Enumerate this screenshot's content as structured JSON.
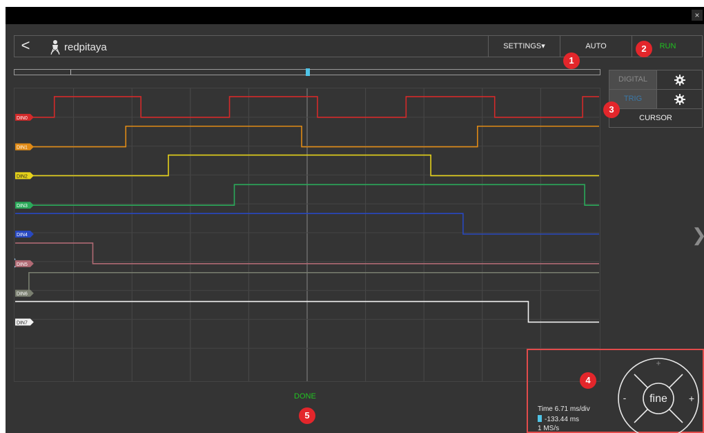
{
  "window": {
    "close_label": "×"
  },
  "header": {
    "back_label": "<",
    "logo_text": "redpitaya",
    "settings_label": "SETTINGS▾",
    "auto_label": "AUTO",
    "run_label": "RUN"
  },
  "side_menu": {
    "digital_label": "DIGITAL",
    "trig_label": "TRIG",
    "cursor_label": "CURSOR"
  },
  "channels": [
    {
      "name": "DIN0",
      "color": "#d42a2a",
      "label_color": "#d42a2a"
    },
    {
      "name": "DIN1",
      "color": "#e08a15",
      "label_color": "#e08a15"
    },
    {
      "name": "DIN2",
      "color": "#e6d21a",
      "label_color": "#e6d21a"
    },
    {
      "name": "DIN3",
      "color": "#2aaa5a",
      "label_color": "#2aaa5a"
    },
    {
      "name": "DIN4",
      "color": "#2848c0",
      "label_color": "#2848c0"
    },
    {
      "name": "DIN5",
      "color": "#b06a74",
      "label_color": "#b06a74"
    },
    {
      "name": "DIN6",
      "color": "#7a7f70",
      "label_color": "#7a7f70"
    },
    {
      "name": "DIN7",
      "color": "#f2f2f2",
      "label_color": "#f2f2f2"
    }
  ],
  "status": {
    "done_label": "DONE"
  },
  "info": {
    "time_label": "Time 6.71 ms/div",
    "cursor_value": "-133.44 ms",
    "rate": "1 MS/s"
  },
  "nav_wheel": {
    "center_label": "fine",
    "plus": "+",
    "minus": "-"
  },
  "badges": [
    "1",
    "2",
    "3",
    "4",
    "5"
  ],
  "colors": {
    "accent": "#4fc3e6",
    "run": "#20c020",
    "badge": "#e3262b"
  }
}
